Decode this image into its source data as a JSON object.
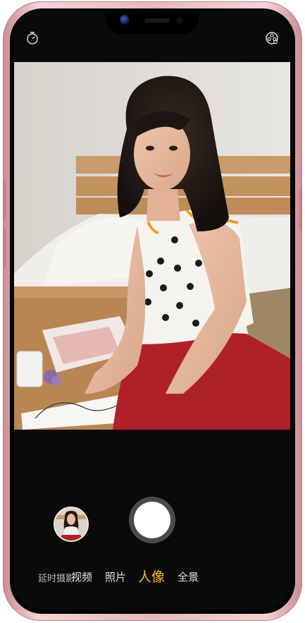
{
  "camera": {
    "modes": [
      {
        "label": "延时摄影"
      },
      {
        "label": "视频"
      },
      {
        "label": "照片"
      },
      {
        "label": "人像",
        "active": true
      },
      {
        "label": "全景"
      }
    ],
    "active_mode_color": "#f3c021"
  },
  "icons": {
    "top_left": "timer-icon",
    "top_right": "filter-icon"
  },
  "colors": {
    "frame": "#e8b9bd",
    "panel": "#0a0a0a",
    "shutter": "#ffffff"
  }
}
